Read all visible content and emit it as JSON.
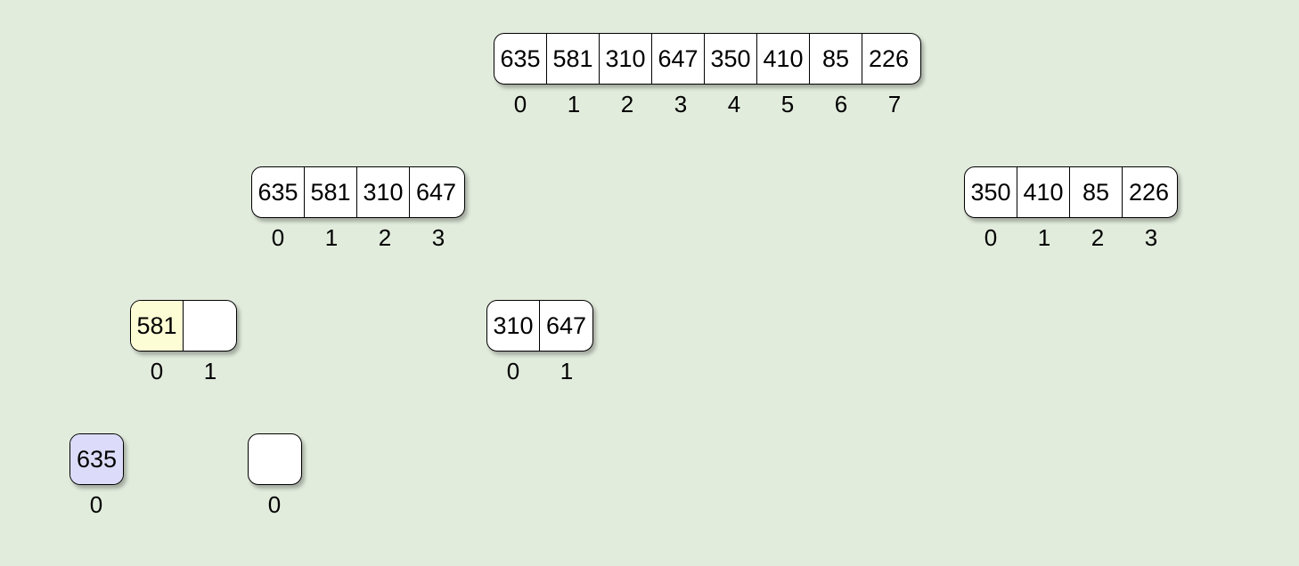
{
  "arrays": [
    {
      "id": "root",
      "cells": [
        "635",
        "581",
        "310",
        "647",
        "350",
        "410",
        "85",
        "226"
      ],
      "indices": [
        "0",
        "1",
        "2",
        "3",
        "4",
        "5",
        "6",
        "7"
      ],
      "highlights": [
        null,
        null,
        null,
        null,
        null,
        null,
        null,
        null
      ]
    },
    {
      "id": "left",
      "cells": [
        "635",
        "581",
        "310",
        "647"
      ],
      "indices": [
        "0",
        "1",
        "2",
        "3"
      ],
      "highlights": [
        null,
        null,
        null,
        null
      ]
    },
    {
      "id": "right",
      "cells": [
        "350",
        "410",
        "85",
        "226"
      ],
      "indices": [
        "0",
        "1",
        "2",
        "3"
      ],
      "highlights": [
        null,
        null,
        null,
        null
      ]
    },
    {
      "id": "left-left",
      "cells": [
        "581",
        ""
      ],
      "indices": [
        "0",
        "1"
      ],
      "highlights": [
        "yellow",
        null
      ]
    },
    {
      "id": "left-right",
      "cells": [
        "310",
        "647"
      ],
      "indices": [
        "0",
        "1"
      ],
      "highlights": [
        null,
        null
      ]
    },
    {
      "id": "leaf-a",
      "cells": [
        "635"
      ],
      "indices": [
        "0"
      ],
      "highlights": [
        "purple"
      ]
    },
    {
      "id": "leaf-b",
      "cells": [
        ""
      ],
      "indices": [
        "0"
      ],
      "highlights": [
        null
      ]
    }
  ],
  "colors": {
    "background": "#e2ecdd",
    "yellow": "#fdfdd5",
    "purple": "#dcdcfa"
  }
}
